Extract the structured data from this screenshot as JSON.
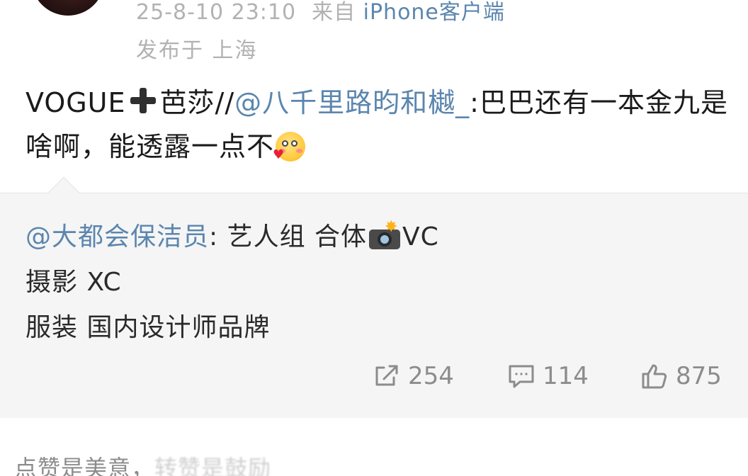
{
  "header": {
    "timestamp": "25-8-10 23:10",
    "source_prefix": "来自",
    "source_app": "iPhone客户端",
    "location": "发布于 上海"
  },
  "post": {
    "prefix": "VOGUE",
    "after_plus": "芭莎//",
    "mention": "@八千里路昀和樾_",
    "text_after_mention": ":巴巴还有一本金九是啥啊，能透露一点不",
    "plus_emoji_name": "heavy-plus-icon",
    "end_emoji_name": "blush-heart-emoji"
  },
  "quote": {
    "mention": "@大都会保洁员",
    "line1_rest": ": 艺人组 合体",
    "line1_tail": "VC",
    "camera_emoji_name": "camera-flash-icon",
    "line2": "摄影 XC",
    "line3": "服装 国内设计师品牌",
    "repost_count": "254",
    "comment_count": "114",
    "like_count": "875"
  },
  "footer": {
    "text": "点赞是美意，",
    "faded_text": "转赞是鼓励"
  },
  "colors": {
    "link": "#5b86ae",
    "meta": "#b2b2b2",
    "quote_bg": "#f5f5f5",
    "action_gray": "#8c8c8c"
  }
}
